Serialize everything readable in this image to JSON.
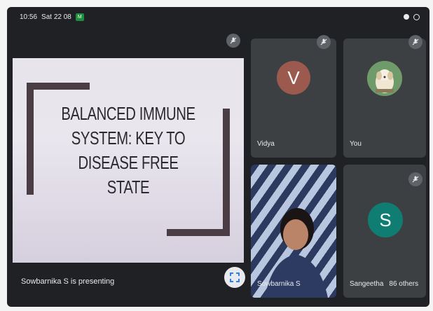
{
  "status_bar": {
    "time": "10:56",
    "date": "Sat 22 08",
    "app_badge": "M"
  },
  "presentation": {
    "slide_title_lines": [
      "BALANCED IMMUNE",
      "SYSTEM: KEY TO",
      "DISEASE FREE STATE"
    ],
    "presenting_label": "Sowbarnika S is presenting"
  },
  "participants": [
    {
      "name": "Vidya",
      "avatar_letter": "V",
      "avatar_color": "#9c5a4f",
      "muted": true
    },
    {
      "name": "You",
      "avatar_type": "photo",
      "muted": true
    },
    {
      "name": "Sowbarnika S",
      "avatar_type": "video",
      "muted": false
    },
    {
      "name": "Sangeetha",
      "avatar_letter": "S",
      "avatar_color": "#0f7d72",
      "muted": true,
      "others_label": "86 others"
    }
  ],
  "colors": {
    "background": "#202124",
    "tile": "#3c4043",
    "text": "#e8eaed"
  },
  "icons": [
    "mic-off-icon",
    "fullscreen-icon",
    "wifi-icon",
    "battery-icon"
  ]
}
